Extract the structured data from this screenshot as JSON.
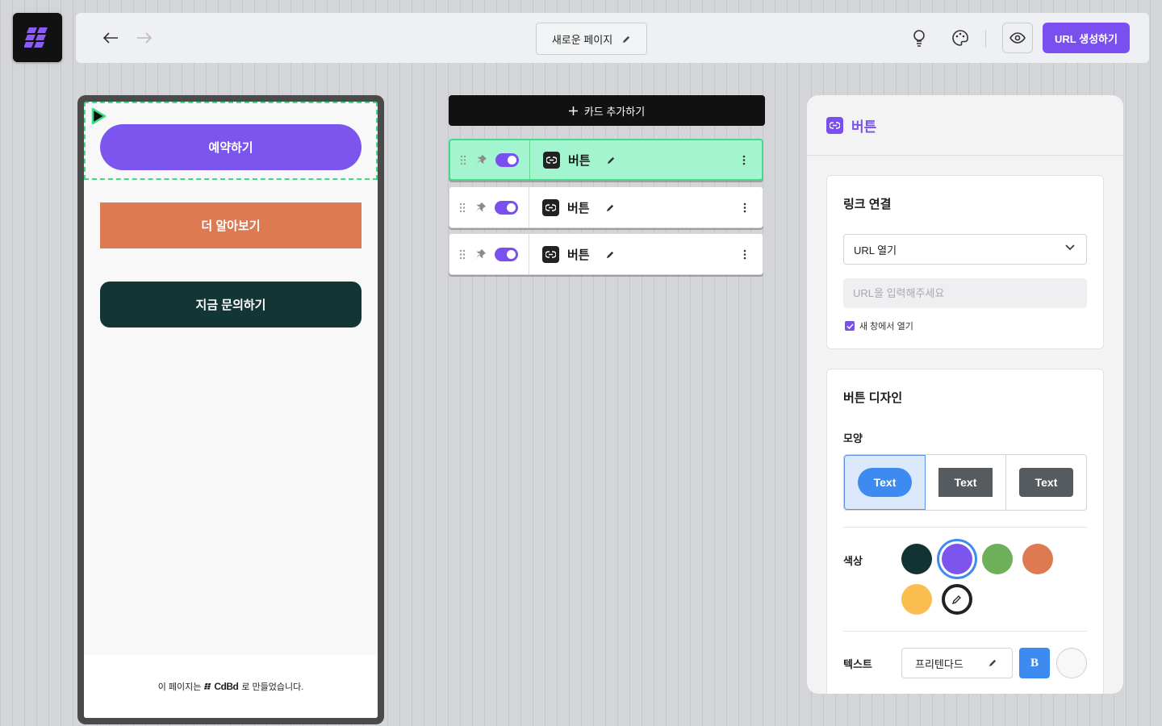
{
  "header": {
    "page_title": "새로운 페이지",
    "generate_url_label": "URL 생성하기"
  },
  "preview": {
    "buttons": [
      {
        "label": "예약하기",
        "color": "#7b55ee"
      },
      {
        "label": "더 알아보기",
        "color": "#dd7a52"
      },
      {
        "label": "지금 문의하기",
        "color": "#133534"
      }
    ],
    "footer_prefix": "이 페이지는",
    "footer_brand": "CdBd",
    "footer_suffix": "로 만들었습니다."
  },
  "cards": {
    "add_label": "카드 추가하기",
    "items": [
      {
        "title": "버튼",
        "enabled": true,
        "active": true
      },
      {
        "title": "버튼",
        "enabled": true,
        "active": false
      },
      {
        "title": "버튼",
        "enabled": true,
        "active": false
      }
    ]
  },
  "panel": {
    "title": "버튼",
    "link": {
      "section_title": "링크 연결",
      "select_value": "URL 열기",
      "url_placeholder": "URL을 입력해주세요",
      "new_window_label": "새 창에서 열기",
      "new_window_checked": true
    },
    "design": {
      "section_title": "버튼 디자인",
      "shape_label": "모양",
      "shape_options": [
        {
          "label": "Text",
          "style": "round",
          "selected": true
        },
        {
          "label": "Text",
          "style": "square",
          "selected": false
        },
        {
          "label": "Text",
          "style": "rounded",
          "selected": false
        }
      ],
      "color_label": "색상",
      "colors": [
        "#123334",
        "#7b55ee",
        "#6eb05a",
        "#dd7a52",
        "#fbbd50"
      ],
      "selected_color": "#7b55ee",
      "text_label": "텍스트",
      "font_value": "프리텐다드",
      "bold_label": "B"
    }
  }
}
